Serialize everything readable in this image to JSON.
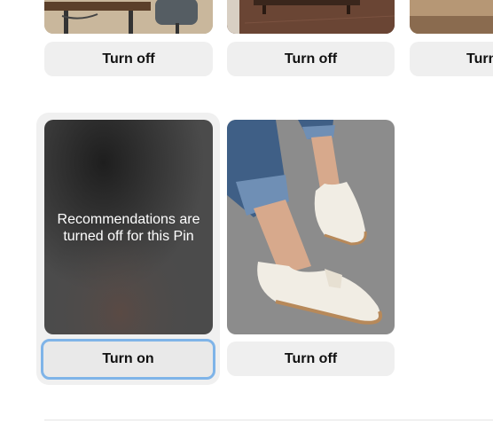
{
  "top_row": {
    "buttons": [
      "Turn off",
      "Turn off",
      "Turn"
    ]
  },
  "bottom_row": {
    "card1": {
      "overlay_text_line1": "Recommendations are",
      "overlay_text_line2": "turned off for this Pin",
      "button": "Turn on"
    },
    "card2": {
      "button": "Turn off"
    }
  },
  "colors": {
    "button_bg": "#efefef",
    "focus_ring": "#7fb4e8",
    "highlight_bg": "#f0f0f0"
  }
}
